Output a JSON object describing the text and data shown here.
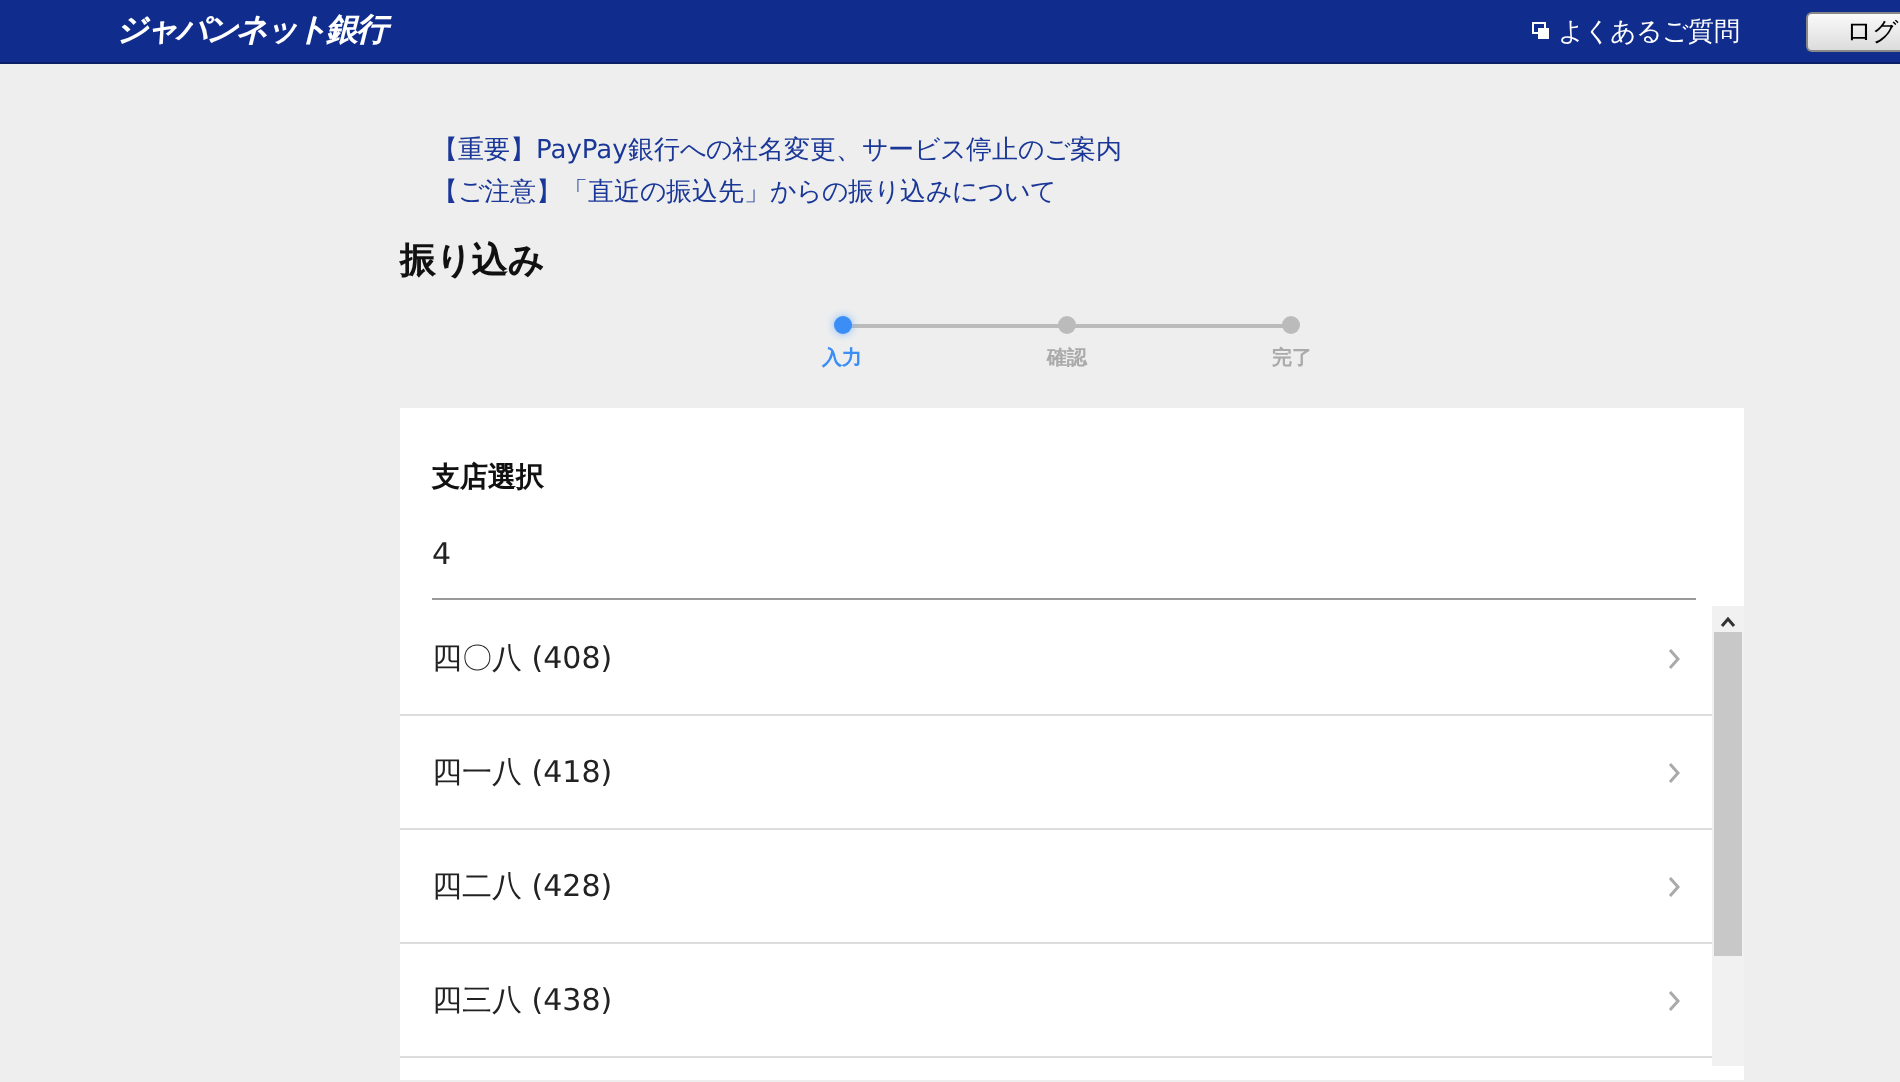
{
  "header": {
    "logo": "ジャパンネット銀行",
    "faq_link": "よくあるご質問",
    "login_button": "ログ"
  },
  "notices": [
    "【重要】PayPay銀行への社名変更、サービス停止のご案内",
    "【ご注意】「直近の振込先」からの振り込みについて"
  ],
  "page_title": "振り込み",
  "steps": [
    {
      "label": "入力",
      "selected": true
    },
    {
      "label": "確認",
      "selected": false
    },
    {
      "label": "完了",
      "selected": false
    }
  ],
  "branch_select": {
    "label": "支店選択",
    "value": "4"
  },
  "branches": [
    "四〇八 (408)",
    "四一八 (418)",
    "四二八 (428)",
    "四三八 (438)"
  ]
}
